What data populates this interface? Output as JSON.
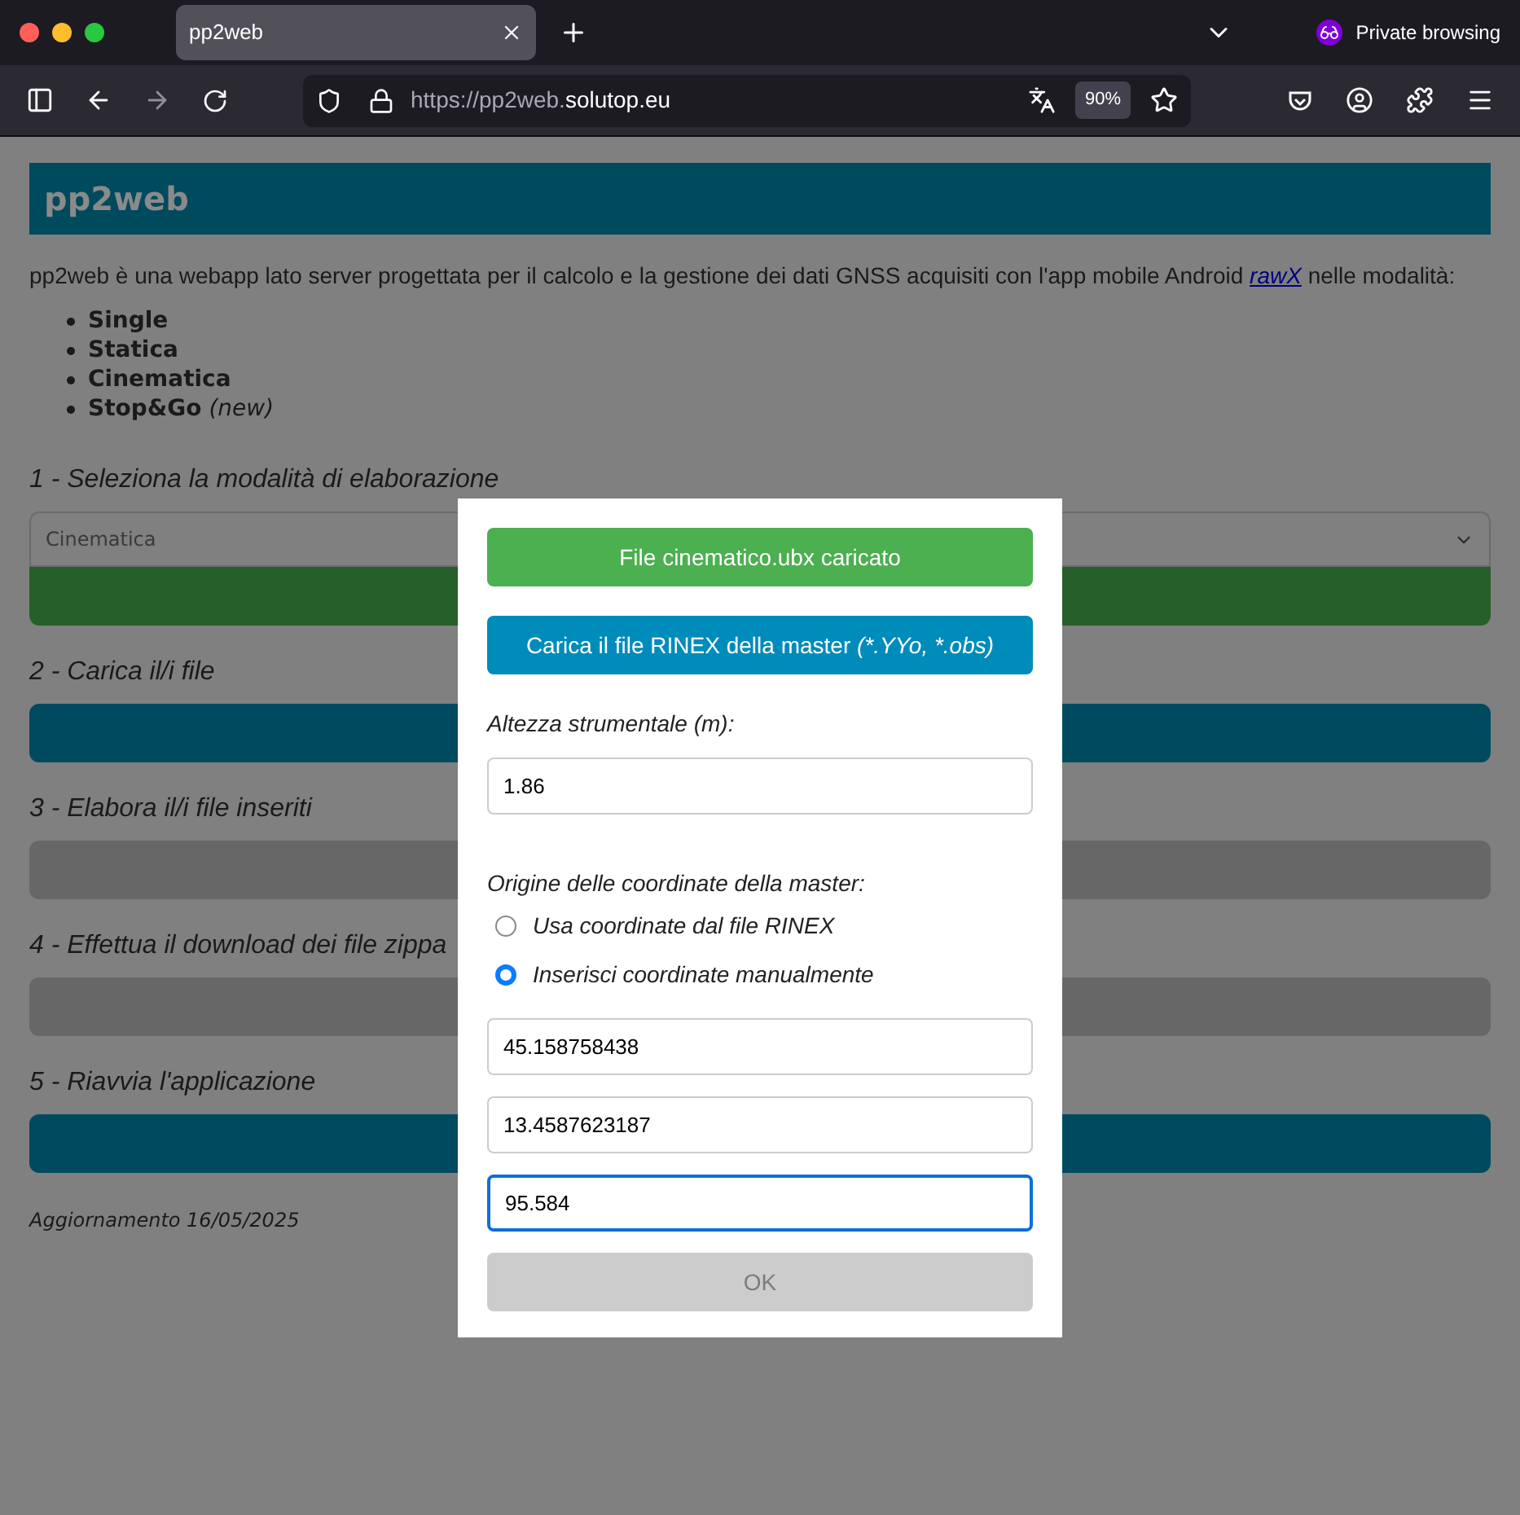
{
  "browser": {
    "tab_title": "pp2web",
    "url_prefix": "https://pp2web.",
    "url_domain": "solutop.eu",
    "zoom": "90%",
    "private_label": "Private browsing"
  },
  "page": {
    "title": "pp2web",
    "intro_before": "pp2web è una webapp lato server progettata per il calcolo e la gestione dei dati GNSS acquisiti con l'app mobile Android ",
    "intro_link": "rawX",
    "intro_after": " nelle modalità:",
    "modes": [
      {
        "name": "Single"
      },
      {
        "name": "Statica"
      },
      {
        "name": "Cinematica"
      },
      {
        "name": "Stop&Go",
        "note": "(new)"
      }
    ],
    "steps": [
      {
        "heading": "1 - Seleziona la modalità di elaborazione",
        "select_value": "Cinematica",
        "kind": "confirm"
      },
      {
        "heading": "2 - Carica il/i file",
        "kind": "action"
      },
      {
        "heading": "3 - Elabora il/i file inseriti",
        "kind": "disabled"
      },
      {
        "heading": "4 - Effettua il download dei file zippa",
        "kind": "disabled"
      },
      {
        "heading": "5 - Riavvia l'applicazione",
        "kind": "action"
      }
    ],
    "update": "Aggiornamento 16/05/2025"
  },
  "modal": {
    "uploaded_button": "File cinematico.ubx caricato",
    "rinex_button": {
      "label": "Carica il file RINEX della master",
      "hint": "(*.YYo, *.obs)"
    },
    "height_label": "Altezza strumentale (m):",
    "height_value": "1.86",
    "origin_label": "Origine delle coordinate della master:",
    "origin_options": [
      {
        "label": "Usa coordinate dal file RINEX",
        "selected": false
      },
      {
        "label": "Inserisci coordinate manualmente",
        "selected": true
      }
    ],
    "coordinates": [
      {
        "value": "45.158758438",
        "focused": false
      },
      {
        "value": "13.4587623187",
        "focused": false
      },
      {
        "value": "95.584",
        "focused": true
      }
    ],
    "ok_button": {
      "label": "OK",
      "disabled": true
    }
  }
}
